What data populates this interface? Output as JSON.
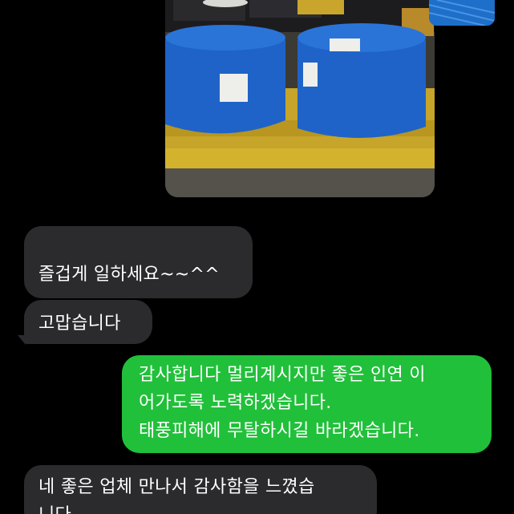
{
  "messages": [
    {
      "direction": "incoming",
      "lines": "즐겁게 일하세요~~^^"
    },
    {
      "direction": "incoming",
      "lines": "고맙습니다"
    },
    {
      "direction": "outgoing",
      "lines": "감사합니다 멀리계시지만 좋은 인연 이\n어가도록 노력하겠습니다.\n태풍피해에 무탈하시길 바라겠습니다."
    },
    {
      "direction": "incoming",
      "lines": "네 좋은 업체 만나서 감사함을 느꼈습\n니다"
    }
  ],
  "colors": {
    "background": "#000000",
    "incoming_bubble": "#2b2b2d",
    "outgoing_bubble": "#21c03a",
    "wrap_blue": "#1f63c8",
    "pallet_yellow": "#d6b324"
  },
  "attachments": [
    {
      "type": "photo",
      "subject": "blue-wrapped-rolls-on-yellow-pallet"
    },
    {
      "type": "photo",
      "subject": "blue-wrap-partial"
    }
  ]
}
